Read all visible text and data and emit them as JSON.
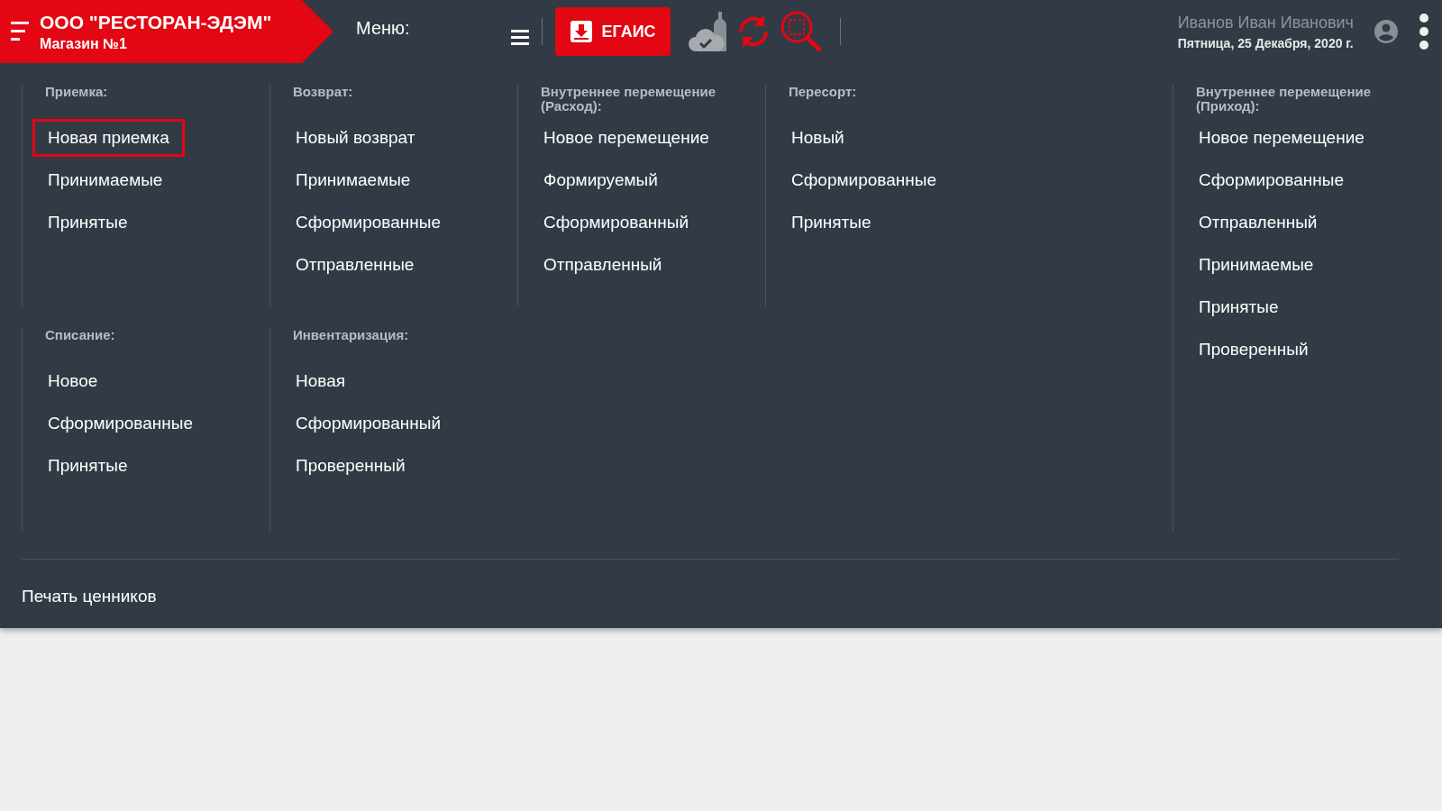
{
  "header": {
    "company": "ООО \"РЕСТОРАН-ЭДЭМ\"",
    "store": "Магазин №1",
    "menu_label": "Меню:",
    "egais_button": "ЕГАИС",
    "user_name": "Иванов Иван Иванович",
    "date": "Пятница, 25 Декабря, 2020 г."
  },
  "sections": [
    {
      "title": "Приемка:",
      "items": [
        {
          "label": "Новая приемка",
          "selected": true
        },
        {
          "label": "Принимаемые",
          "selected": false
        },
        {
          "label": "Принятые",
          "selected": false
        }
      ]
    },
    {
      "title": "Возврат:",
      "items": [
        {
          "label": "Новый возврат",
          "selected": false
        },
        {
          "label": "Принимаемые",
          "selected": false
        },
        {
          "label": "Сформированные",
          "selected": false
        },
        {
          "label": "Отправленные",
          "selected": false
        }
      ]
    },
    {
      "title": "Внутреннее перемещение (Расход):",
      "items": [
        {
          "label": "Новое перемещение",
          "selected": false
        },
        {
          "label": "Формируемый",
          "selected": false
        },
        {
          "label": "Сформированный",
          "selected": false
        },
        {
          "label": "Отправленный",
          "selected": false
        }
      ]
    },
    {
      "title": "Пересорт:",
      "items": [
        {
          "label": "Новый",
          "selected": false
        },
        {
          "label": "Сформированные",
          "selected": false
        },
        {
          "label": "Принятые",
          "selected": false
        }
      ]
    },
    {
      "title": "Внутреннее перемещение (Приход):",
      "items": [
        {
          "label": "Новое перемещение",
          "selected": false
        },
        {
          "label": "Сформированные",
          "selected": false
        },
        {
          "label": "Отправленный",
          "selected": false
        },
        {
          "label": "Принимаемые",
          "selected": false
        },
        {
          "label": "Принятые",
          "selected": false
        },
        {
          "label": "Проверенный",
          "selected": false
        }
      ]
    },
    {
      "title": "Списание:",
      "items": [
        {
          "label": "Новое",
          "selected": false
        },
        {
          "label": "Сформированные",
          "selected": false
        },
        {
          "label": "Принятые",
          "selected": false
        }
      ]
    },
    {
      "title": "Инвентаризация:",
      "items": [
        {
          "label": "Новая",
          "selected": false
        },
        {
          "label": "Сформированный",
          "selected": false
        },
        {
          "label": "Проверенный",
          "selected": false
        }
      ]
    }
  ],
  "footer_link": "Печать ценников"
}
